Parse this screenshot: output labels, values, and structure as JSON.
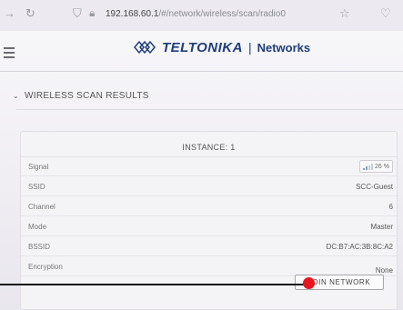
{
  "browser": {
    "url_host": "192.168.60.1",
    "url_path": "/#/network/wireless/scan/radio0"
  },
  "header": {
    "brand_name": "TELTONIKA",
    "brand_separator": "|",
    "brand_sub": "Networks"
  },
  "section": {
    "title": "WIRELESS SCAN RESULTS"
  },
  "card": {
    "title": "INSTANCE: 1",
    "rows": [
      {
        "label": "Signal",
        "value": "26 %"
      },
      {
        "label": "SSID",
        "value": "SCC-Guest"
      },
      {
        "label": "Channel",
        "value": "6"
      },
      {
        "label": "Mode",
        "value": "Master"
      },
      {
        "label": "BSSID",
        "value": "DC:B7:AC:3B:8C:A2"
      },
      {
        "label": "Encryption",
        "value": "None"
      }
    ],
    "join_label": "JOIN NETWORK"
  },
  "colors": {
    "brand": "#1f3f7a",
    "annotation_dot": "#e8141e"
  }
}
